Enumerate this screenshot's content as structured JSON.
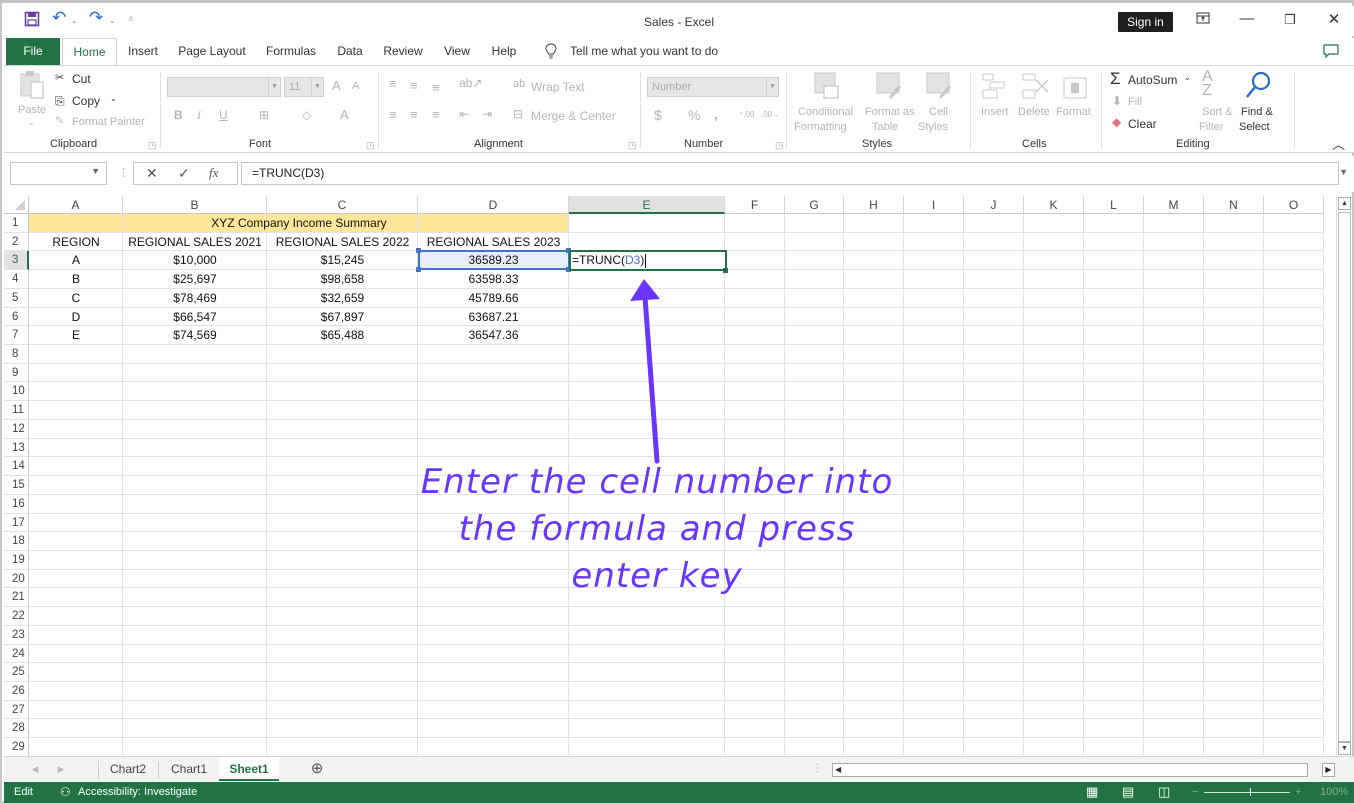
{
  "window": {
    "title": "Sales  -  Excel",
    "sign_in": "Sign in",
    "buttons": [
      "ribbon-display-options",
      "minimize",
      "restore",
      "close"
    ]
  },
  "quick_access": {
    "icons": [
      "save-icon",
      "undo-icon",
      "redo-icon",
      "customize-icon"
    ]
  },
  "tabs": [
    {
      "label": "File"
    },
    {
      "label": "Home",
      "active": true
    },
    {
      "label": "Insert"
    },
    {
      "label": "Page Layout"
    },
    {
      "label": "Formulas"
    },
    {
      "label": "Data"
    },
    {
      "label": "Review"
    },
    {
      "label": "View"
    },
    {
      "label": "Help"
    }
  ],
  "tell_me": "Tell me what you want to do",
  "ribbon": {
    "clipboard": {
      "label": "Clipboard",
      "paste": "Paste",
      "cut": "Cut",
      "copy": "Copy",
      "format_painter": "Format Painter"
    },
    "font": {
      "label": "Font",
      "font_name": "",
      "font_size": "11",
      "bold": "B",
      "italic": "I",
      "underline": "U",
      "grow": "A",
      "shrink": "A",
      "color": "A"
    },
    "alignment": {
      "label": "Alignment",
      "wrap_text": "Wrap Text",
      "merge_center": "Merge & Center"
    },
    "number": {
      "label": "Number",
      "format": "Number",
      "currency": "$",
      "percent": "%",
      "comma": ",",
      "inc_decimal": "←.0 .00",
      "dec_decimal": ".00 →.0"
    },
    "styles": {
      "label": "Styles",
      "conditional_1": "Conditional",
      "conditional_2": "Formatting",
      "format_table_1": "Format as",
      "format_table_2": "Table",
      "cell_styles_1": "Cell",
      "cell_styles_2": "Styles"
    },
    "cells": {
      "label": "Cells",
      "insert": "Insert",
      "delete": "Delete",
      "format": "Format"
    },
    "editing": {
      "label": "Editing",
      "autosum": "AutoSum",
      "fill": "Fill",
      "clear": "Clear",
      "sort_1": "Sort &",
      "sort_2": "Filter",
      "find_1": "Find &",
      "find_2": "Select"
    }
  },
  "formula_bar": {
    "name_box": "",
    "cancel": "✕",
    "enter": "✓",
    "fx": "fx",
    "formula": "=TRUNC(D3)"
  },
  "columns": [
    "A",
    "B",
    "C",
    "D",
    "E",
    "F",
    "G",
    "H",
    "I",
    "J",
    "K",
    "L",
    "M",
    "N",
    "O"
  ],
  "selected_column": "E",
  "rows": [
    "1",
    "2",
    "3",
    "4",
    "5",
    "6",
    "7",
    "8",
    "9",
    "10",
    "11",
    "12",
    "13",
    "14",
    "15",
    "16",
    "17",
    "18",
    "19",
    "20",
    "21",
    "22",
    "23",
    "24",
    "25",
    "26",
    "27",
    "28",
    "29"
  ],
  "selected_row": "3",
  "sheet": {
    "title": "XYZ Company Income Summary",
    "headers": [
      "REGION",
      "REGIONAL SALES 2021",
      "REGIONAL SALES 2022",
      "REGIONAL SALES 2023"
    ],
    "data": [
      [
        "A",
        "$10,000",
        "$15,245",
        "36589.23"
      ],
      [
        "B",
        "$25,697",
        "$98,658",
        "63598.33"
      ],
      [
        "C",
        "$78,469",
        "$32,659",
        "45789.66"
      ],
      [
        "D",
        "$66,547",
        "$67,897",
        "63687.21"
      ],
      [
        "E",
        "$74,569",
        "$65,488",
        "36547.36"
      ]
    ],
    "editing_cell": {
      "address": "E3",
      "prefix": "=TRUNC(",
      "ref": "D3",
      "suffix": ")"
    },
    "referenced_cell": "D3"
  },
  "sheet_tabs": [
    {
      "label": "Chart2"
    },
    {
      "label": "Chart1"
    },
    {
      "label": "Sheet1",
      "active": true
    }
  ],
  "status": {
    "mode": "Edit",
    "accessibility": "Accessibility: Investigate",
    "zoom": "100%"
  },
  "annotation": {
    "lines": [
      "Enter the cell number into",
      "the formula and press",
      "enter key"
    ],
    "color": "#6a35ff"
  },
  "colors": {
    "excel_green": "#217346",
    "title_fill": "#ffe699",
    "ref_blue": "#4472c4"
  }
}
